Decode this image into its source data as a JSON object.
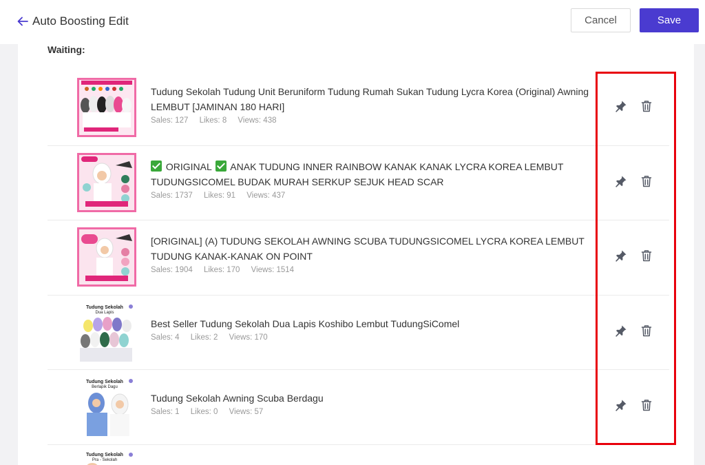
{
  "header": {
    "title": "Auto Boosting Edit",
    "cancel_label": "Cancel",
    "save_label": "Save"
  },
  "section_label": "Waiting:",
  "stat_labels": {
    "sales": "Sales:",
    "likes": "Likes:",
    "views": "Views:"
  },
  "products": [
    {
      "name_parts": [
        "Tudung Sekolah Tudung Unit Beruniform Tudung Rumah Sukan Tudung Lycra Korea (Original) Awning LEMBUT [JAMINAN 180 HARI]"
      ],
      "sales": "127",
      "likes": "8",
      "views": "438"
    },
    {
      "name_parts": [
        "ORIGINAL",
        "ANAK TUDUNG INNER RAINBOW KANAK KANAK LYCRA KOREA LEMBUT TUDUNGSICOMEL BUDAK MURAH SERKUP SEJUK HEAD SCAR"
      ],
      "sales": "1737",
      "likes": "91",
      "views": "437"
    },
    {
      "name_parts": [
        "[ORIGINAL] (A) TUDUNG SEKOLAH AWNING SCUBA TUDUNGSICOMEL LYCRA KOREA LEMBUT TUDUNG KANAK-KANAK ON POINT"
      ],
      "sales": "1904",
      "likes": "170",
      "views": "1514"
    },
    {
      "name_parts": [
        "Best Seller Tudung Sekolah Dua Lapis Koshibo Lembut TudungSiComel"
      ],
      "sales": "4",
      "likes": "2",
      "views": "170"
    },
    {
      "name_parts": [
        "Tudung Sekolah Awning Scuba Berdagu"
      ],
      "sales": "1",
      "likes": "0",
      "views": "57"
    }
  ],
  "thumb_texts": {
    "t4": [
      "Tudung Sekolah",
      "Dua Lapis"
    ],
    "t5": [
      "Tudung Sekolah",
      "Berlapik Dagu"
    ],
    "t6": [
      "Tudung Sekolah",
      "Pra - Sekolah"
    ]
  },
  "colors": {
    "accent": "#4a3bd0",
    "highlight": "#e8000b",
    "pink_frame": "#f06aa6",
    "check_green": "#3aa83a"
  },
  "icons": {
    "back": "arrow-left-icon",
    "pin": "pin-icon",
    "delete": "trash-icon",
    "check": "green-check-icon"
  }
}
